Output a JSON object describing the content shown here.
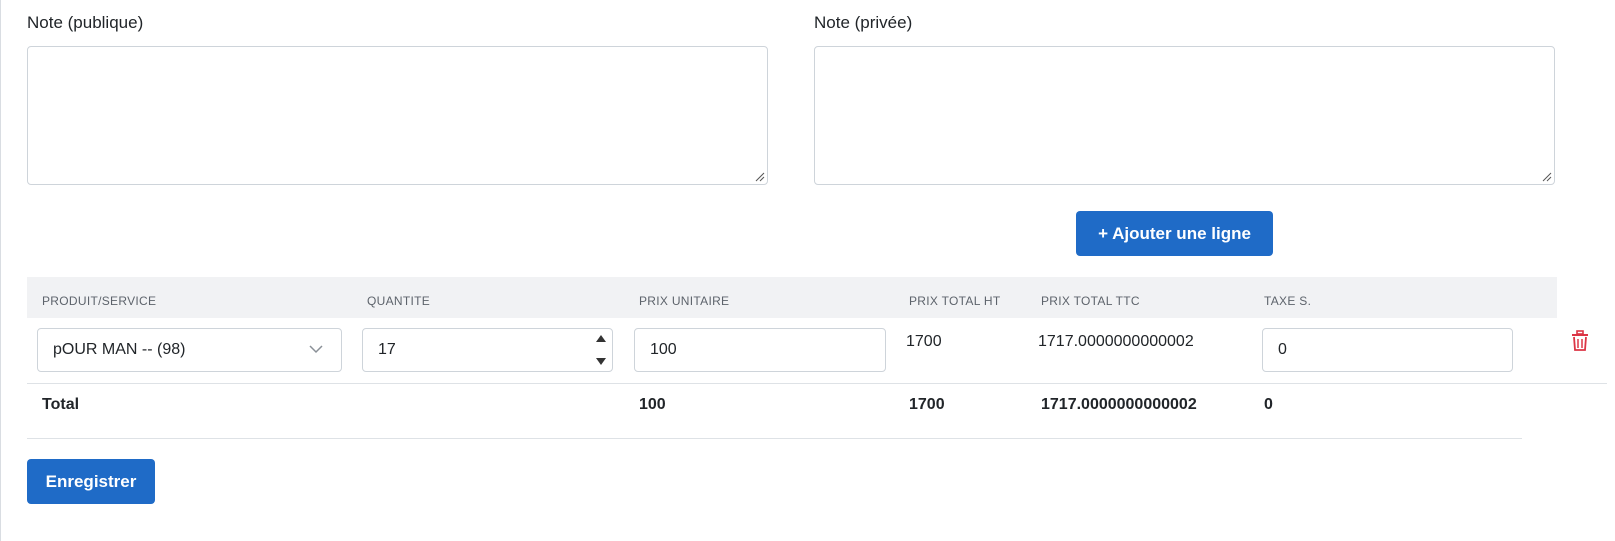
{
  "notes": {
    "public_label": "Note (publique)",
    "private_label": "Note (privée)",
    "public_value": "",
    "private_value": ""
  },
  "add_line_button": "+ Ajouter une ligne",
  "table": {
    "headers": [
      "PRODUIT/SERVICE",
      "QUANTITE",
      "PRIX UNITAIRE",
      "PRIX TOTAL HT",
      "PRIX TOTAL TTC",
      "TAXE S."
    ],
    "rows": [
      {
        "product": "pOUR MAN -- (98)",
        "quantity": "17",
        "unit_price": "100",
        "total_ht": "1700",
        "total_ttc": "1717.0000000000002",
        "tax": "0"
      }
    ],
    "totals": {
      "label": "Total",
      "unit_price": "100",
      "total_ht": "1700",
      "total_ttc": "1717.0000000000002",
      "tax": "0"
    }
  },
  "save_button": "Enregistrer",
  "colors": {
    "primary": "#1f6bc7",
    "danger": "#dc3545",
    "header_bg": "#f1f2f4"
  }
}
